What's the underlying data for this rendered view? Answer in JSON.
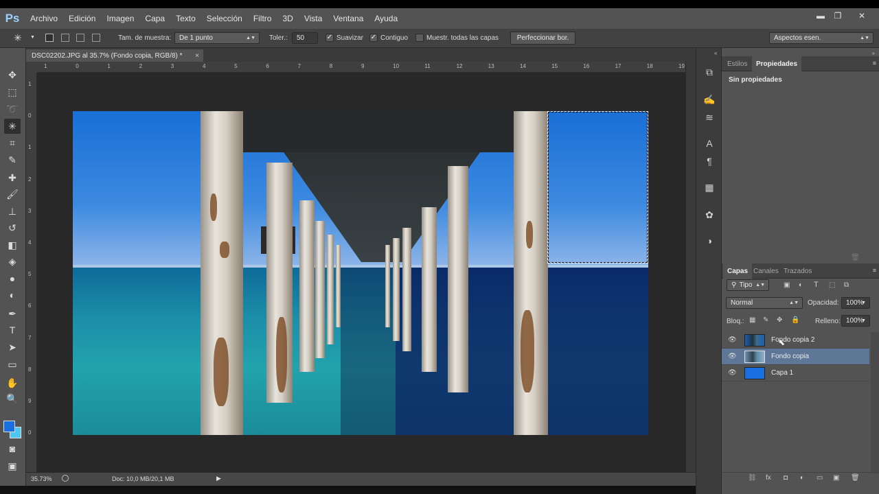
{
  "app": {
    "logo": "Ps"
  },
  "menu": [
    "Archivo",
    "Edición",
    "Imagen",
    "Capa",
    "Texto",
    "Selección",
    "Filtro",
    "3D",
    "Vista",
    "Ventana",
    "Ayuda"
  ],
  "window_controls": {
    "minimize": "▬",
    "restore": "❐",
    "close": "✕"
  },
  "options": {
    "sample_size_label": "Tam. de muestra:",
    "sample_size_value": "De 1 punto",
    "tolerance_label": "Toler.:",
    "tolerance_value": "50",
    "antialias_label": "Suavizar",
    "antialias_checked": "✓",
    "contiguous_label": "Contiguo",
    "contiguous_checked": "✓",
    "sample_all_label": "Muestr. todas las capas",
    "refine_button": "Perfeccionar bor.",
    "workspace": "Aspectos esen."
  },
  "document": {
    "tab_title": "DSC02202.JPG al 35.7% (Fondo copia, RGB/8) *",
    "close": "×",
    "zoom": "35.73%",
    "doc_size": "Doc: 10,0 MB/20,1 MB",
    "arrow": "▶"
  },
  "ruler": {
    "h": [
      "1",
      "0",
      "1",
      "2",
      "3",
      "4",
      "5",
      "6",
      "7",
      "8",
      "9",
      "10",
      "11",
      "12",
      "13",
      "14",
      "15",
      "16",
      "17",
      "18",
      "19"
    ],
    "v": [
      "1",
      "0",
      "1",
      "2",
      "3",
      "4",
      "5",
      "6",
      "7",
      "8",
      "9",
      "0"
    ]
  },
  "properties_panel": {
    "tabs": [
      "Estilos",
      "Propiedades"
    ],
    "content": "Sin propiedades"
  },
  "layers_panel": {
    "tabs": [
      "Capas",
      "Canales",
      "Trazados"
    ],
    "filter": "Tipo",
    "blend_mode": "Normal",
    "opacity_label": "Opacidad:",
    "opacity_value": "100%",
    "lock_label": "Bloq.:",
    "fill_label": "Relleno:",
    "fill_value": "100%",
    "layers": [
      {
        "name": "Fondo copia 2",
        "selected": false
      },
      {
        "name": "Fondo copia",
        "selected": true
      },
      {
        "name": "Capa 1",
        "selected": false
      }
    ]
  },
  "colors": {
    "foreground": "#1a6fe0",
    "background": "#4fc6f0",
    "selection_highlight": "#5f7797"
  }
}
